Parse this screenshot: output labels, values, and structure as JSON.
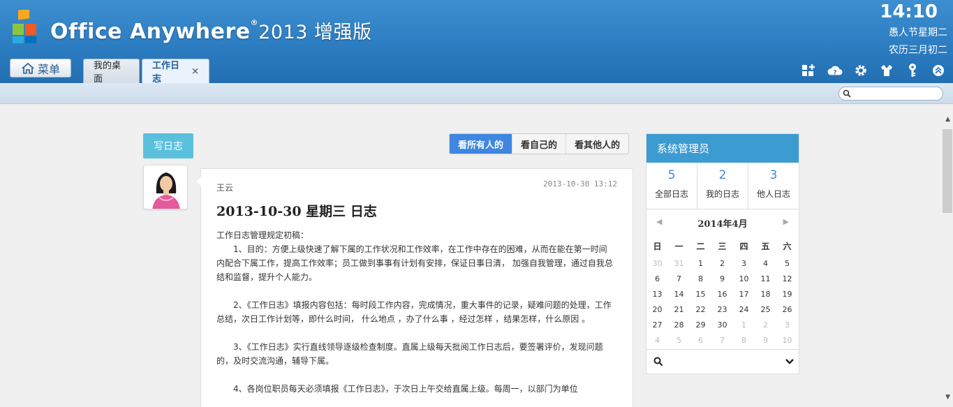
{
  "header": {
    "brand": "Office Anywhere",
    "reg_mark": "®",
    "version": "2013 增强版",
    "clock": "14:10",
    "date_line1": "愚人节星期二",
    "date_line2": "农历三月初二"
  },
  "nav": {
    "menu_label": "菜单",
    "tabs": [
      {
        "label": "我的桌面"
      },
      {
        "label": "工作日志",
        "close": "×"
      }
    ],
    "toolbar_icons": [
      "add-widget-icon",
      "cloud-help-icon",
      "gear-icon",
      "shirt-theme-icon",
      "key-icon",
      "collapse-up-icon"
    ]
  },
  "search": {
    "placeholder": ""
  },
  "main": {
    "write_button": "写日志",
    "filters": [
      "看所有人的",
      "看自己的",
      "看其他人的"
    ],
    "active_filter": 0,
    "post": {
      "author": "王云",
      "time": "2013-10-30 13:12",
      "title": "2013-10-30  星期三  日志",
      "intro": "工作日志管理规定初稿：",
      "para1": "1、目的：方便上级快速了解下属的工作状况和工作效率，在工作中存在的困难，从而在能在第一时间内配合下属工作，提高工作效率；员工做到事事有计划有安排，保证日事日清， 加强自我管理，通过自我总结和监督，提升个人能力。",
      "para2": "2、《工作日志》填报内容包括：每时段工作内容，完成情况，重大事件的记录，疑难问题的处理，工作总结，次日工作计划等，即什么时间， 什么地点 ，办了什么事 ，经过怎样 ，结果怎样，什么原因 。",
      "para3": "3、《工作日志》实行直线领导逐级检查制度。直属上级每天批阅工作日志后，要签署评价，发现问题的，及时交流沟通，辅导下属。",
      "para4": "4、各岗位职员每天必须填报《工作日志》，于次日上午交给直属上级。每周一，以部门为单位"
    }
  },
  "panel": {
    "title": "系统管理员",
    "stats": [
      {
        "num": "5",
        "label": "全部日志"
      },
      {
        "num": "2",
        "label": "我的日志"
      },
      {
        "num": "3",
        "label": "他人日志"
      }
    ],
    "calendar": {
      "month_label": "2014年4月",
      "weekdays": [
        "日",
        "一",
        "二",
        "三",
        "四",
        "五",
        "六"
      ],
      "days": [
        [
          "30",
          "31",
          "1",
          "2",
          "3",
          "4",
          "5"
        ],
        [
          "6",
          "7",
          "8",
          "9",
          "10",
          "11",
          "12"
        ],
        [
          "13",
          "14",
          "15",
          "16",
          "17",
          "18",
          "19"
        ],
        [
          "20",
          "21",
          "22",
          "23",
          "24",
          "25",
          "26"
        ],
        [
          "27",
          "28",
          "29",
          "30",
          "1",
          "2",
          "3"
        ],
        [
          "4",
          "5",
          "6",
          "7",
          "8",
          "9",
          "10"
        ]
      ]
    }
  },
  "colors": {
    "header_blue": "#2b7bc0",
    "accent_blue": "#3e86e0",
    "panel_head": "#3c9bd1",
    "write_button": "#5bc0de"
  }
}
